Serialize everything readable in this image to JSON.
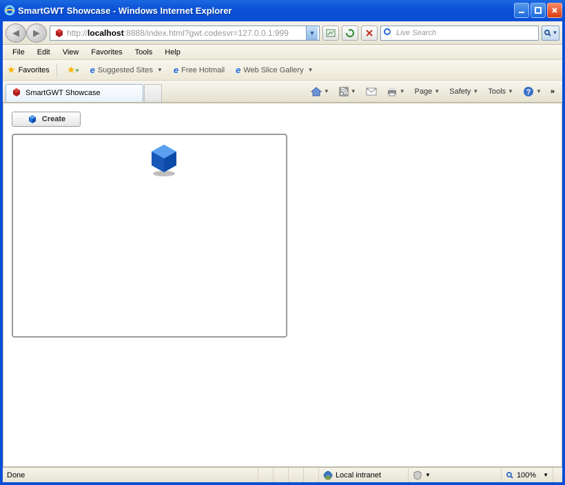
{
  "window": {
    "title": "SmartGWT Showcase - Windows Internet Explorer"
  },
  "address": {
    "protocol": "http://",
    "host": "localhost",
    "port_path": ":8888/index.html?gwt.codesvr=127.0.0.1:999"
  },
  "search": {
    "placeholder": "Live Search"
  },
  "menubar": [
    "File",
    "Edit",
    "View",
    "Favorites",
    "Tools",
    "Help"
  ],
  "favorites": {
    "label": "Favorites",
    "links": [
      "Suggested Sites",
      "Free Hotmail",
      "Web Slice Gallery"
    ]
  },
  "tab": {
    "title": "SmartGWT Showcase"
  },
  "commandbar": [
    "Page",
    "Safety",
    "Tools"
  ],
  "page": {
    "create_button": "Create"
  },
  "statusbar": {
    "status": "Done",
    "zone": "Local intranet",
    "zoom": "100%"
  }
}
